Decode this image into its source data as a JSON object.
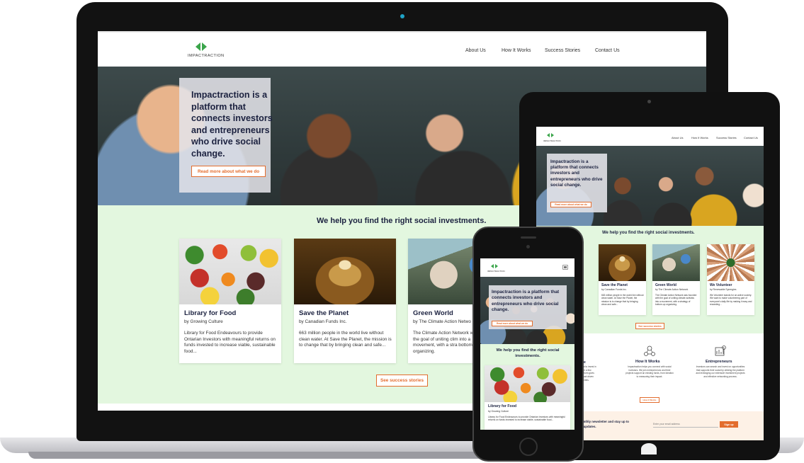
{
  "colors": {
    "green_band": "#e3f7df",
    "accent_orange": "#e36d2e",
    "logo_green": "#3aa54a",
    "heading_navy": "#1c2240",
    "device_black": "#111111",
    "laptop_silver": "#d9d9dc"
  },
  "brand": {
    "name": "IMPACTRACTION"
  },
  "nav": {
    "about": "About Us",
    "how": "How It Works",
    "stories": "Success Stories",
    "contact": "Contact Us"
  },
  "hero": {
    "headline": "Impactraction is a platform that connects investors and entrepreneurs who drive social change.",
    "button": "Read more about what we do"
  },
  "section": {
    "heading": "We help you find the right social investments."
  },
  "cards": [
    {
      "title": "Library for Food",
      "sub": "by Growing Culture",
      "body": "Library for Food Endeavours to provide Ontarian Investors with meaningful returns on funds invested to increase viable, sustainable food..."
    },
    {
      "title": "Save the Planet",
      "sub": "by Canadian Funds Inc.",
      "body": "663 million people in the world live without clean water. At Save the Planet, the mission is to change that by bringing clean and safe..."
    },
    {
      "title": "Green World",
      "sub": "by The Climate Action Netwo",
      "body": "The Climate Action Network with the goal of uniting clim into a movement, with a stra bottom-up organizing."
    },
    {
      "title": "We Volunteer",
      "sub": "by Renewable Synergies",
      "body": "We Volunteer stands for an active society. We want to make volunteering part of everyone's daily life by making it easy and rewarding..."
    }
  ],
  "tablet_cards": [
    {
      "title": "Save the Planet",
      "sub": "by Canadian Funds Inc.",
      "body": "663 million people in the world live without clean water. At Save the Planet, the mission is to change that by bringing clean and safe..."
    },
    {
      "title": "Green World",
      "sub": "by The Climate Action Network",
      "body": "The Climate Action Network was founded with the goal of uniting climate activists into a movement, with a strategy of bottom-up organizing."
    },
    {
      "title": "We Volunteer",
      "sub": "by Renewable Synergies",
      "body": "We Volunteer stands for an active society. We want to make volunteering part of everyone's daily life by making it easy and rewarding..."
    }
  ],
  "stories_button": "See success stories",
  "how": {
    "left_title": "ure",
    "left_body": "ncial to invest in\nough a few\nplatform gives\nimpact driven\nmunities.",
    "title": "How It Works",
    "body": "Impactraction helps you connect with social investors. We join entrepreneurs and their projects support an existing funds, from ideation to measuring their impact.",
    "button": "How It Works",
    "ent_title": "Entrepreneurs",
    "ent_body": "Investors can search and invest on opportunities that supports their social by utilizing the platform and leveraging our extensive investment projects and effective networking process."
  },
  "newsletter": {
    "text_1": "monthly newsletter and stay up to",
    "text_2": "nd updates.",
    "placeholder": "Enter your email address",
    "button": "Sign up"
  }
}
